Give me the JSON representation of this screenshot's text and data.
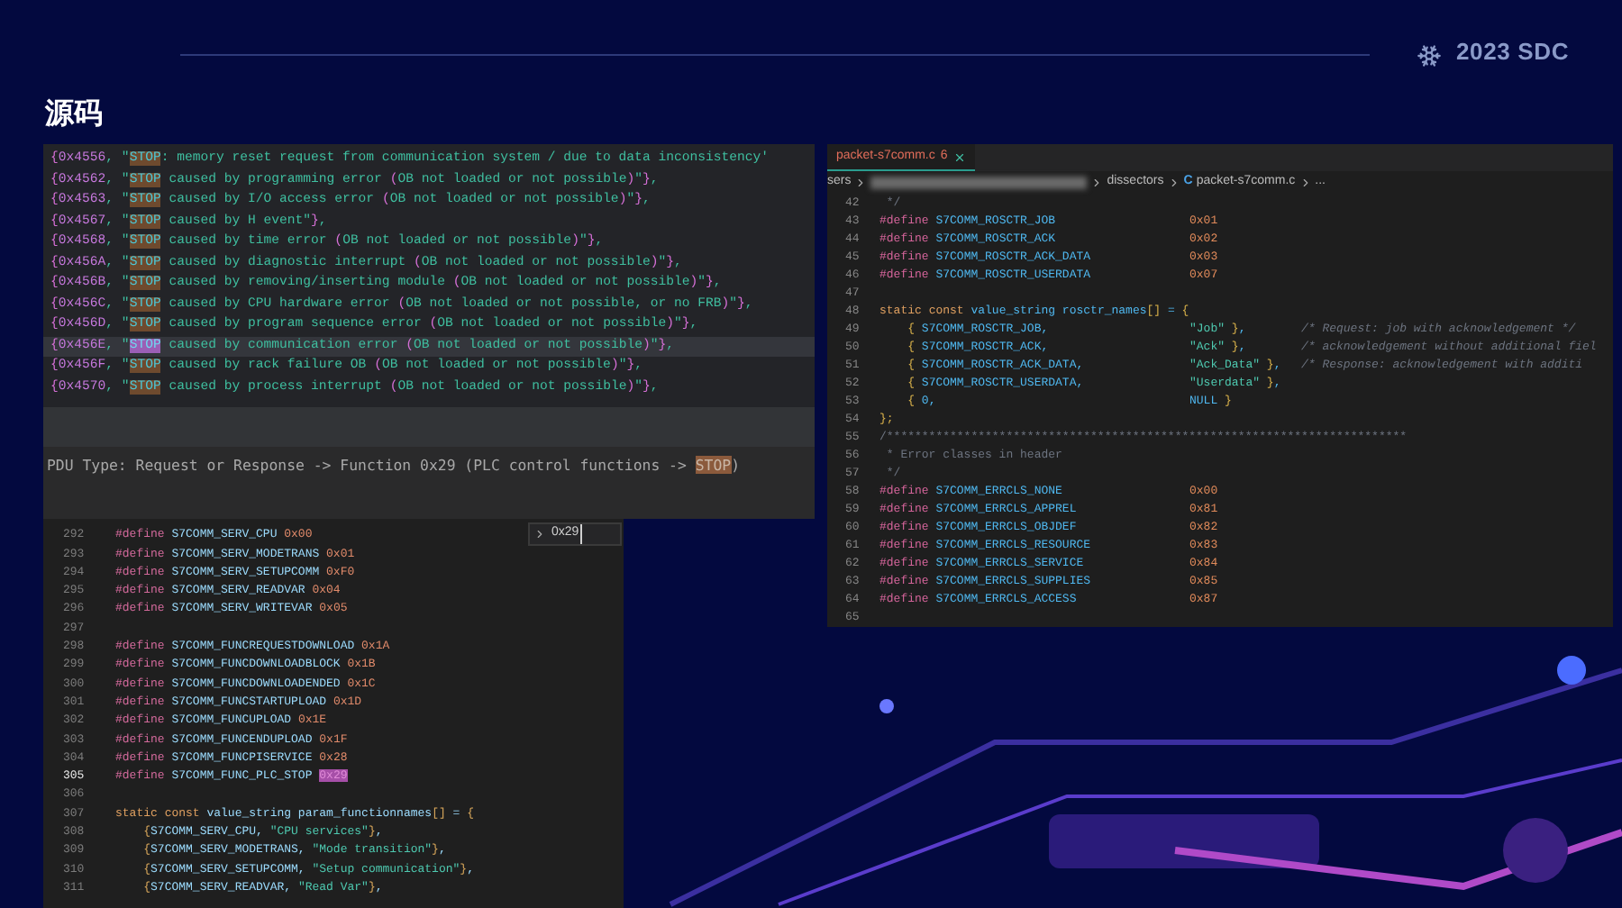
{
  "header": {
    "brand": "2023 SDC"
  },
  "title": "源码",
  "error_codes": {
    "lines": [
      {
        "code": "{0x4556, \"",
        "match": "STOP",
        "rest": ": memory reset request from communication system / due to data inconsistency'",
        "selected": false
      },
      {
        "code": "{0x4562, \"",
        "match": "STOP",
        "rest": " caused by programming error (OB not loaded or not possible)\"},",
        "selected": false
      },
      {
        "code": "{0x4563, \"",
        "match": "STOP",
        "rest": " caused by I/O access error (OB not loaded or not possible)\"},",
        "selected": false
      },
      {
        "code": "{0x4567, \"",
        "match": "STOP",
        "rest": " caused by H event\"},",
        "selected": false
      },
      {
        "code": "{0x4568, \"",
        "match": "STOP",
        "rest": " caused by time error (OB not loaded or not possible)\"},",
        "selected": false
      },
      {
        "code": "{0x456A, \"",
        "match": "STOP",
        "rest": " caused by diagnostic interrupt (OB not loaded or not possible)\"},",
        "selected": false
      },
      {
        "code": "{0x456B, \"",
        "match": "STOP",
        "rest": " caused by removing/inserting module (OB not loaded or not possible)\"},",
        "selected": false
      },
      {
        "code": "{0x456C, \"",
        "match": "STOP",
        "rest": " caused by CPU hardware error (OB not loaded or not possible, or no FRB)\"},",
        "selected": false
      },
      {
        "code": "{0x456D, \"",
        "match": "STOP",
        "rest": " caused by program sequence error (OB not loaded or not possible)\"},",
        "selected": false
      },
      {
        "code": "{0x456E, \"",
        "match": "STOP",
        "rest": " caused by communication error (OB not loaded or not possible)\"},",
        "selected": true
      },
      {
        "code": "{0x456F, \"",
        "match": "STOP",
        "rest": " caused by rack failure OB (OB not loaded or not possible)\"},",
        "selected": false
      },
      {
        "code": "{0x4570, \"",
        "match": "STOP",
        "rest": " caused by process interrupt (OB not loaded or not possible)\"},",
        "selected": false
      }
    ]
  },
  "dissector_tree": {
    "text": "PDU Type: Request or Response -> Function 0x29 (PLC control functions -> ",
    "match": "STOP",
    "rest": ")"
  },
  "header_editor": {
    "search": {
      "value": "0x29"
    },
    "lines": [
      {
        "number": "292",
        "text": "#define S7COMM_SERV_CPU 0x00",
        "selected": false
      },
      {
        "number": "293",
        "text": "#define S7COMM_SERV_MODETRANS 0x01",
        "selected": false
      },
      {
        "number": "294",
        "text": "#define S7COMM_SERV_SETUPCOMM 0xF0",
        "selected": false
      },
      {
        "number": "295",
        "text": "#define S7COMM_SERV_READVAR 0x04",
        "selected": false
      },
      {
        "number": "296",
        "text": "#define S7COMM_SERV_WRITEVAR 0x05",
        "selected": false
      },
      {
        "number": "297",
        "selected": false
      },
      {
        "number": "298",
        "text": "#define S7COMM_FUNCREQUESTDOWNLOAD 0x1A",
        "selected": false
      },
      {
        "number": "299",
        "text": "#define S7COMM_FUNCDOWNLOADBLOCK 0x1B",
        "selected": false
      },
      {
        "number": "300",
        "text": "#define S7COMM_FUNCDOWNLOADENDED 0x1C",
        "selected": false
      },
      {
        "number": "301",
        "text": "#define S7COMM_FUNCSTARTUPLOAD 0x1D",
        "selected": false
      },
      {
        "number": "302",
        "text": "#define S7COMM_FUNCUPLOAD 0x1E",
        "selected": false
      },
      {
        "number": "303",
        "text": "#define S7COMM_FUNCENDUPLOAD 0x1F",
        "selected": false
      },
      {
        "number": "304",
        "text": "#define S7COMM_FUNCPISERVICE 0x28",
        "selected": false
      },
      {
        "number": "305",
        "text": "#define S7COMM_FUNC_PLC_STOP ",
        "match": "0x29",
        "selected": true
      },
      {
        "number": "306",
        "selected": false
      },
      {
        "number": "307",
        "text": "static const value_string param_functionnames[] = {",
        "selected": false
      },
      {
        "number": "308",
        "text": "    {S7COMM_SERV_CPU, \"CPU services\"},",
        "selected": false
      },
      {
        "number": "309",
        "text": "    {S7COMM_SERV_MODETRANS, \"Mode transition\"},",
        "selected": false
      },
      {
        "number": "310",
        "text": "    {S7COMM_SERV_SETUPCOMM, \"Setup communication\"},",
        "selected": false
      },
      {
        "number": "311",
        "text": "    {S7COMM_SERV_READVAR, \"Read Var\"},",
        "selected": false
      }
    ]
  },
  "source_editor": {
    "tab": {
      "label": "packet-s7comm.c",
      "problems": "6"
    },
    "breadcrumb": [
      {
        "kind": "folder",
        "label": "sers"
      },
      {
        "kind": "redacted"
      },
      {
        "kind": "folder",
        "label": "dissectors"
      },
      {
        "kind": "file",
        "icon": "C",
        "label": "packet-s7comm.c"
      },
      {
        "kind": "folder",
        "label": "..."
      }
    ],
    "lines": [
      {
        "number": "42",
        "text": " */"
      },
      {
        "number": "43",
        "text": "#define S7COMM_ROSCTR_JOB",
        "value": "0x01"
      },
      {
        "number": "44",
        "text": "#define S7COMM_ROSCTR_ACK",
        "value": "0x02"
      },
      {
        "number": "45",
        "text": "#define S7COMM_ROSCTR_ACK_DATA",
        "value": "0x03"
      },
      {
        "number": "46",
        "text": "#define S7COMM_ROSCTR_USERDATA",
        "value": "0x07"
      },
      {
        "number": "47"
      },
      {
        "number": "48",
        "text": "static const value_string rosctr_names[] = {"
      },
      {
        "number": "49",
        "text": "    { S7COMM_ROSCTR_JOB,",
        "value": "\"Job\" },",
        "comment": "/* Request: job with acknowledgement */"
      },
      {
        "number": "50",
        "text": "    { S7COMM_ROSCTR_ACK,",
        "value": "\"Ack\" },",
        "comment": "/* acknowledgement without additional fiel"
      },
      {
        "number": "51",
        "text": "    { S7COMM_ROSCTR_ACK_DATA,",
        "value": "\"Ack_Data\" },",
        "comment": "/* Response: acknowledgement with additi"
      },
      {
        "number": "52",
        "text": "    { S7COMM_ROSCTR_USERDATA,",
        "value": "\"Userdata\" },"
      },
      {
        "number": "53",
        "text": "    { 0,",
        "value": "NULL }"
      },
      {
        "number": "54",
        "text": "};"
      },
      {
        "number": "55",
        "text": "/**************************************************************************"
      },
      {
        "number": "56",
        "text": " * Error classes in header"
      },
      {
        "number": "57",
        "text": " */"
      },
      {
        "number": "58",
        "text": "#define S7COMM_ERRCLS_NONE",
        "value": "0x00"
      },
      {
        "number": "59",
        "text": "#define S7COMM_ERRCLS_APPREL",
        "value": "0x81"
      },
      {
        "number": "60",
        "text": "#define S7COMM_ERRCLS_OBJDEF",
        "value": "0x82"
      },
      {
        "number": "61",
        "text": "#define S7COMM_ERRCLS_RESOURCE",
        "value": "0x83"
      },
      {
        "number": "62",
        "text": "#define S7COMM_ERRCLS_SERVICE",
        "value": "0x84"
      },
      {
        "number": "63",
        "text": "#define S7COMM_ERRCLS_SUPPLIES",
        "value": "0x85"
      },
      {
        "number": "64",
        "text": "#define S7COMM_ERRCLS_ACCESS",
        "value": "0x87"
      },
      {
        "number": "65"
      }
    ]
  }
}
